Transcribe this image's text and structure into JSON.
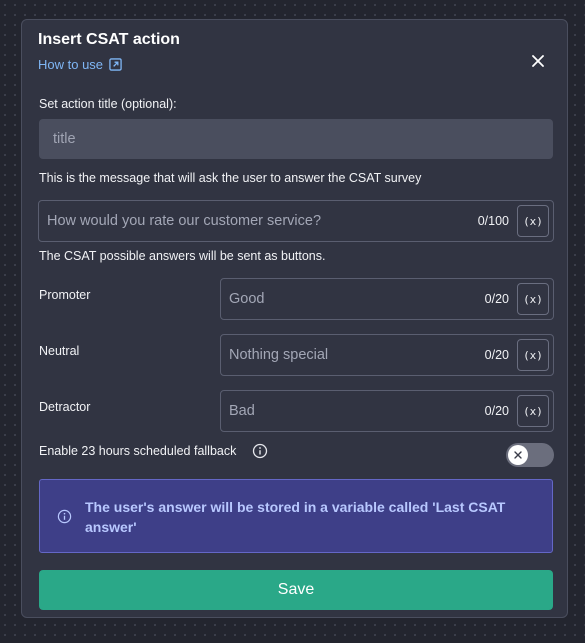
{
  "modal": {
    "title": "Insert CSAT action",
    "how_to_use": "How to use",
    "close_icon": "close-icon",
    "action_title_label": "Set action title (optional):",
    "action_title_placeholder": "title",
    "message_label": "This is the message that will ask the user to answer the CSAT survey",
    "message_field": {
      "placeholder": "How would you rate our customer service?",
      "count": "0/100",
      "var_label": "(x)"
    },
    "answers_label": "The CSAT possible answers will be sent as buttons.",
    "answers": [
      {
        "label": "Promoter",
        "placeholder": "Good",
        "count": "0/20",
        "var_label": "(x)"
      },
      {
        "label": "Neutral",
        "placeholder": "Nothing special",
        "count": "0/20",
        "var_label": "(x)"
      },
      {
        "label": "Detractor",
        "placeholder": "Bad",
        "count": "0/20",
        "var_label": "(x)"
      }
    ],
    "fallback_label": "Enable 23 hours scheduled fallback",
    "fallback_enabled": false,
    "info_message": "The user's answer will be stored in a variable called 'Last CSAT answer'",
    "save_label": "Save"
  },
  "colors": {
    "background": "#23252f",
    "modal": "#313442",
    "link": "#7fb6f5",
    "info_bg": "#3e3f88",
    "info_text": "#b8c8ff",
    "save_button": "#2aa888"
  }
}
